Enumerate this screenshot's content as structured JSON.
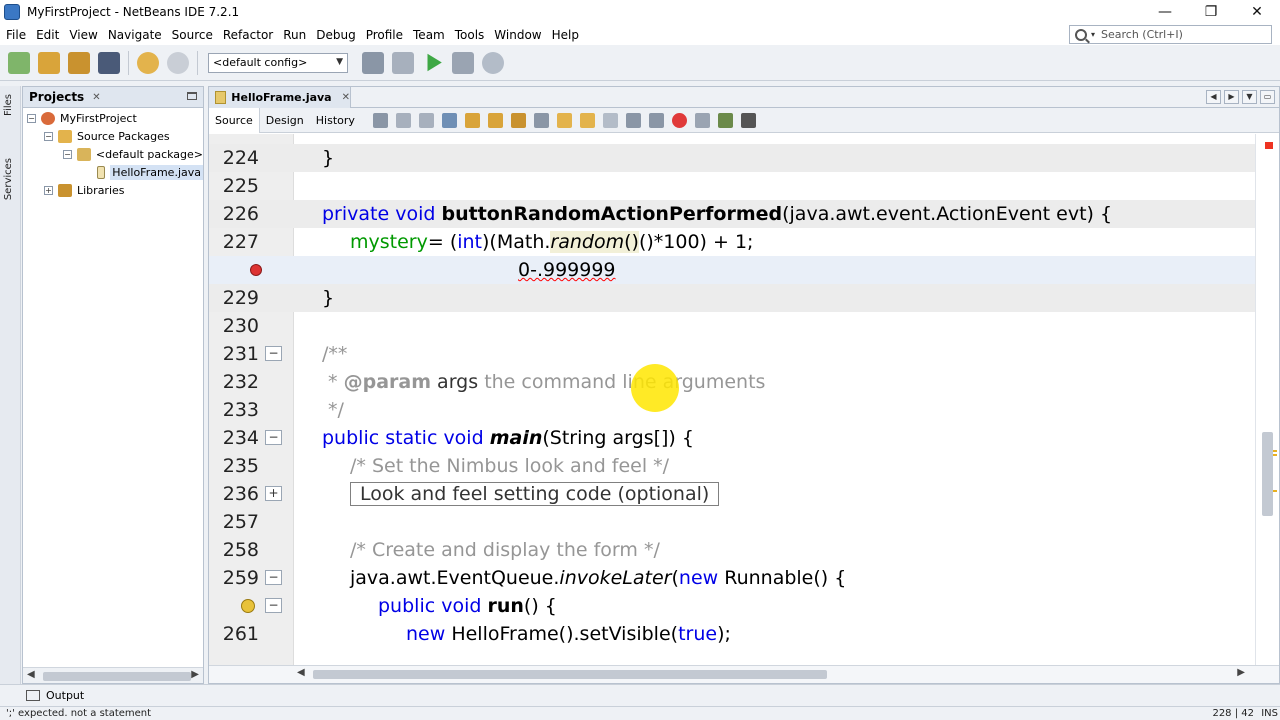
{
  "window": {
    "title": "MyFirstProject - NetBeans IDE 7.2.1",
    "minimize": "—",
    "restore": "❐",
    "close": "✕"
  },
  "menu": [
    "File",
    "Edit",
    "View",
    "Navigate",
    "Source",
    "Refactor",
    "Run",
    "Debug",
    "Profile",
    "Team",
    "Tools",
    "Window",
    "Help"
  ],
  "search": {
    "placeholder": "Search (Ctrl+I)"
  },
  "toolbar": {
    "config": "<default config>"
  },
  "left_strip": {
    "files": "Files",
    "services": "Services"
  },
  "projects": {
    "title": "Projects",
    "close": "✕",
    "tree": {
      "project": "MyFirstProject",
      "source_packages": "Source Packages",
      "default_package": "<default package>",
      "file": "HelloFrame.java",
      "libraries": "Libraries"
    }
  },
  "editor": {
    "tab_label": "HelloFrame.java",
    "tab_close": "✕",
    "views": [
      "Source",
      "Design",
      "History"
    ],
    "lines": {
      "n224": "224",
      "n225": "225",
      "n226": "226",
      "n227": "227",
      "n229": "229",
      "n230": "230",
      "n231": "231",
      "n232": "232",
      "n233": "233",
      "n234": "234",
      "n235": "235",
      "n236": "236",
      "n257": "257",
      "n258": "258",
      "n259": "259",
      "n261": "261"
    },
    "code": {
      "brace_close": "}",
      "kw_private": "private",
      "kw_void": "void",
      "method_name": "buttonRandomActionPerformed",
      "params": "(java.awt.event.ActionEvent evt) {",
      "mystery": "mystery",
      "assign": "= (",
      "kw_int": "int",
      "math_open": ")(Math.",
      "random": "random",
      "math_close": "()*100) + 1;",
      "error_text": "0-.999999",
      "jdoc_open": "/**",
      "jdoc_star": " * ",
      "jdoc_param": "@param",
      "jdoc_args": " args ",
      "jdoc_desc": "the command line arguments",
      "jdoc_close": " */",
      "kw_public": "public",
      "kw_static": "static",
      "main": "main",
      "main_params": "(String args[]) {",
      "comment_nimbus": "/* Set the Nimbus look and feel */",
      "collapsed": "Look and feel setting code (optional)",
      "comment_create": "/* Create and display the form */",
      "eventqueue": "java.awt.EventQueue.",
      "invoke_later": "invokeLater",
      "kw_new": "new",
      "runnable": " Runnable() {",
      "run": "run",
      "run_params": "() {",
      "helloframe": " HelloFrame().setVisible(",
      "kw_true": "true",
      "end_stmt": ");"
    }
  },
  "output": {
    "label": "Output"
  },
  "status": {
    "message": "';' expected. not a statement",
    "position": "228 | 42",
    "mode": "INS"
  },
  "colors": {
    "keyword": "#0000e6",
    "field": "#009900",
    "comment": "#969696",
    "error": "#ff0000",
    "cursor_highlight": "#ffe600"
  }
}
